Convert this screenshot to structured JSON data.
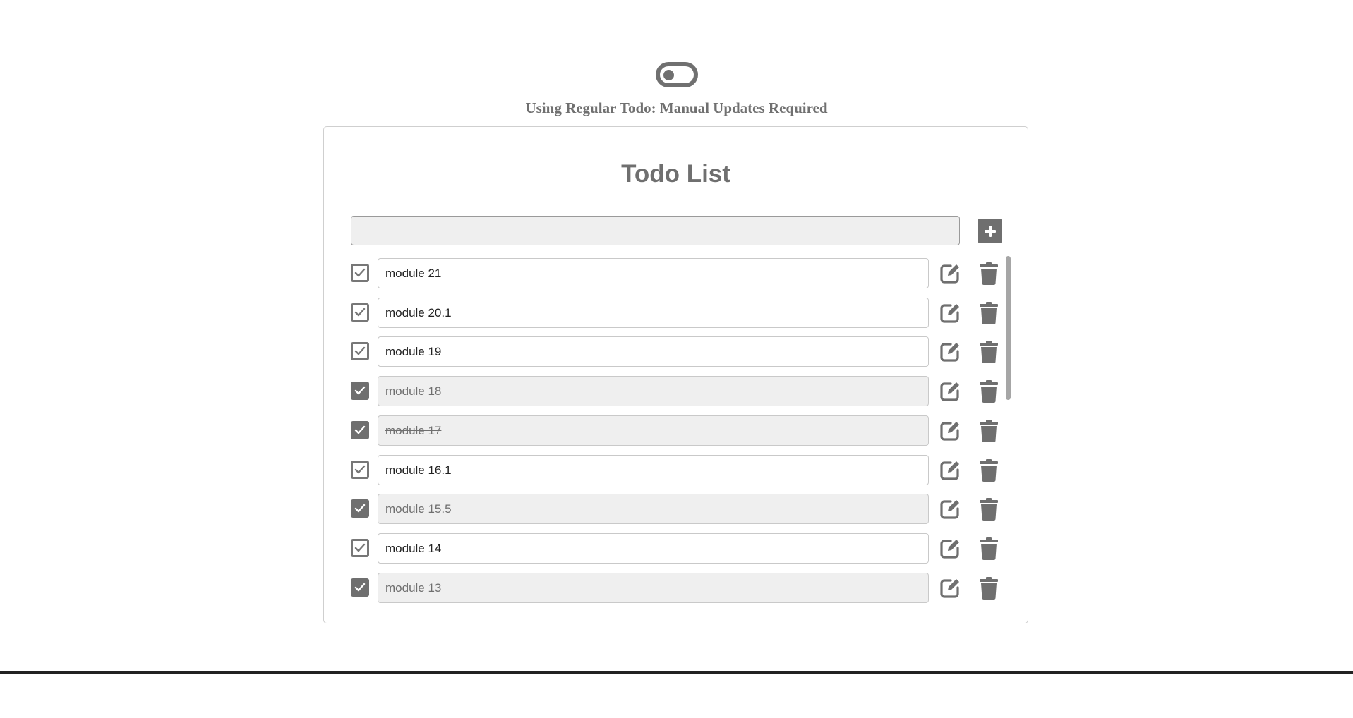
{
  "toggle": {
    "state": "off"
  },
  "mode_text": "Using Regular Todo: Manual Updates Required",
  "card": {
    "title": "Todo List",
    "new_todo": {
      "value": "",
      "placeholder": ""
    }
  },
  "todos": [
    {
      "text": "module 21",
      "done": false
    },
    {
      "text": "module 20.1",
      "done": false
    },
    {
      "text": "module 19",
      "done": false
    },
    {
      "text": "module 18",
      "done": true
    },
    {
      "text": "module 17",
      "done": true
    },
    {
      "text": "module 16.1",
      "done": false
    },
    {
      "text": "module 15.5",
      "done": true
    },
    {
      "text": "module 14",
      "done": false
    },
    {
      "text": "module 13",
      "done": true
    }
  ],
  "icons": {
    "add": "plus-icon",
    "edit": "edit-icon",
    "delete": "trash-icon",
    "check": "check-icon"
  },
  "colors": {
    "accent": "#6f6f6f",
    "done_bg": "#efefef",
    "border": "#cfcfcf"
  }
}
